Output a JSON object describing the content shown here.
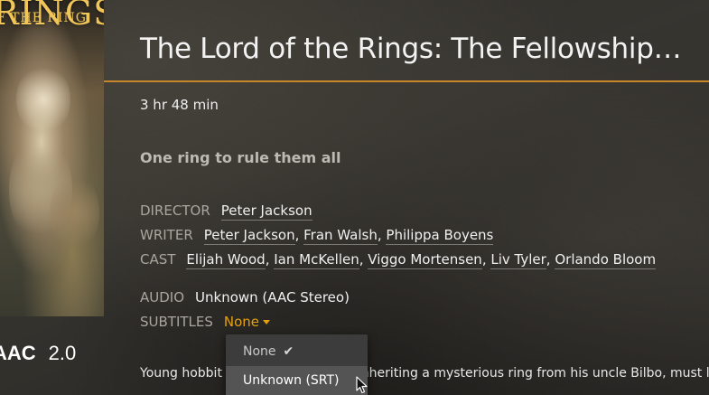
{
  "movie": {
    "title": "The Lord of the Rings: The Fellowship…",
    "runtime": "3 hr 48 min",
    "tagline": "One ring to rule them all",
    "summary": "Young hobbit Frodo Baggins, after inheriting a mysterious ring from his uncle Bilbo, must leave"
  },
  "poster": {
    "title_text": "RINGS",
    "subtitle_text": "F THE RING",
    "audio_codec": "AAC",
    "audio_channels": "2.0"
  },
  "meta": {
    "director_label": "DIRECTOR",
    "directors": [
      "Peter Jackson"
    ],
    "writer_label": "WRITER",
    "writers": [
      "Peter Jackson",
      "Fran Walsh",
      "Philippa Boyens"
    ],
    "cast_label": "CAST",
    "cast": [
      "Elijah Wood",
      "Ian McKellen",
      "Viggo Mortensen",
      "Liv Tyler",
      "Orlando Bloom"
    ],
    "separator": ", ",
    "audio_label": "AUDIO",
    "audio_value": "Unknown (AAC Stereo)",
    "subtitles_label": "SUBTITLES",
    "subtitles_value": "None"
  },
  "subtitle_dropdown": {
    "options": [
      {
        "label": "None",
        "selected": true
      },
      {
        "label": "Unknown (SRT)",
        "selected": false,
        "hovered": true
      }
    ],
    "check_glyph": "✔"
  },
  "colors": {
    "accent": "#e5a00d",
    "rule": "#c8862a",
    "dropdown_bg": "#3c3c3c",
    "dropdown_hover": "#545454"
  }
}
